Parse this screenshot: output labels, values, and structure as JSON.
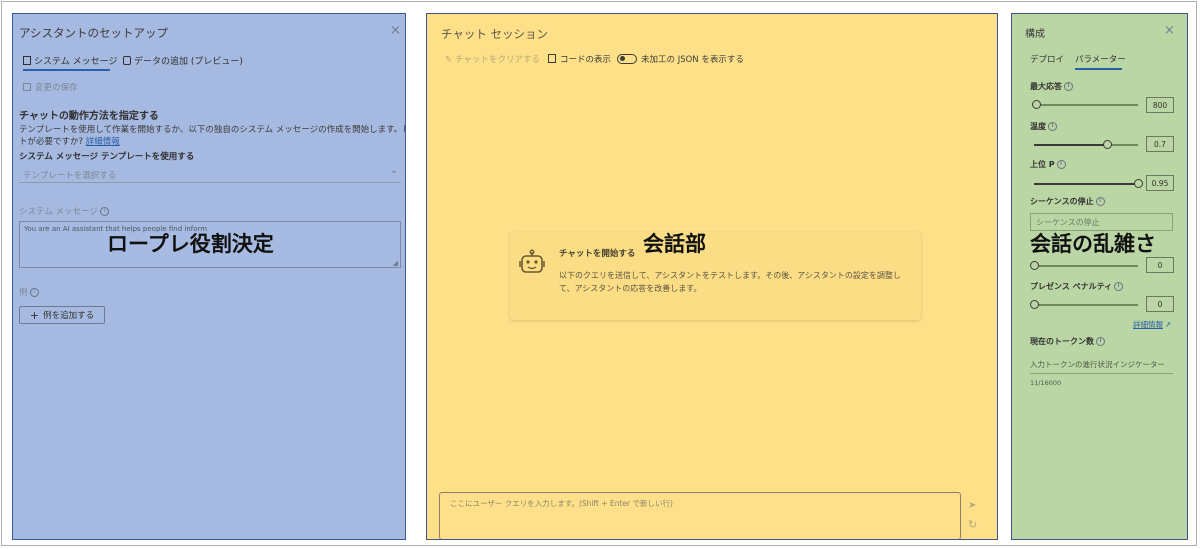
{
  "left_panel": {
    "title": "アシスタントのセットアップ",
    "close_glyph": "×",
    "tabs": [
      {
        "label": "システム メッセージ",
        "icon": "document-icon"
      },
      {
        "label": "データの追加 (プレビュー)",
        "icon": "database-icon"
      }
    ],
    "save_label": "変更の保存",
    "heading": "チャットの動作方法を指定する",
    "description_line1": "テンプレートを使用して作業を開始するか、以下の独自のシステム メッセージの作成を開始します。ヒン",
    "description_line2": "トが必要ですか?",
    "learn_more": "詳細情報",
    "template_label": "システム メッセージ テンプレートを使用する",
    "template_placeholder": "テンプレートを選択する",
    "system_message_label": "システム メッセージ",
    "system_message_value": "You are an AI assistant that helps people find inform",
    "examples_label": "例",
    "add_example_label": "例を追加する",
    "overlay": "ロープレ役割決定"
  },
  "mid_panel": {
    "title": "チャット セッション",
    "clear_chat": "チャットをクリアする",
    "show_code": "コードの表示",
    "show_json": "未加工の JSON を表示する",
    "card_title": "チャットを開始する",
    "card_line1": "以下のクエリを送信して、アシスタントをテストします。その後、アシスタントの設定を調整し",
    "card_line2": "て、アシスタントの応答を改善します。",
    "input_placeholder": "ここにユーザー クエリを入力します。(Shift + Enter で新しい行)",
    "overlay": "会話部"
  },
  "right_panel": {
    "title": "構成",
    "close_glyph": "×",
    "tabs": [
      "デプロイ",
      "パラメーター"
    ],
    "params": [
      {
        "label": "最大応答",
        "value": "800",
        "fraction": 0.02
      },
      {
        "label": "温度",
        "value": "0.7",
        "fraction": 0.7
      },
      {
        "label": "上位 P",
        "value": "0.95",
        "fraction": 1.0
      }
    ],
    "stop_label": "シーケンスの停止",
    "stop_placeholder": "シーケンスの停止",
    "freq_value": "0",
    "presence_label": "プレゼンス ペナルティ",
    "presence_value": "0",
    "learn_more": "詳細情報",
    "tokens_label": "現在のトークン数",
    "tokens_indicator": "入力トークンの進行状況インジケーター",
    "tokens_count": "11/16000",
    "overlay": "会話の乱雑さ"
  }
}
